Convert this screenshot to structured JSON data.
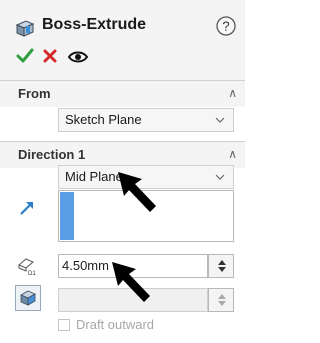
{
  "header": {
    "title": "Boss-Extrude",
    "icons": [
      "extrude-feature-icon",
      "help-icon"
    ],
    "actions": [
      {
        "name": "ok",
        "icon": "checkmark-icon",
        "color": "#2e9e3e"
      },
      {
        "name": "cancel",
        "icon": "x-icon",
        "color": "#d42a2a"
      },
      {
        "name": "preview",
        "icon": "eye-icon",
        "color": "#111111"
      }
    ]
  },
  "from": {
    "title": "From",
    "selected": "Sketch Plane"
  },
  "direction1": {
    "title": "Direction 1",
    "end_condition": "Mid Plane",
    "depth": "4.50mm",
    "draft_label": "Draft outward",
    "draft_checked": false,
    "icons": [
      "reverse-direction-arrow-icon",
      "depth-dimension-icon",
      "draft-icon"
    ]
  },
  "colors": {
    "accent": "#5b9ee8",
    "header_bg": "#f4f4f4"
  }
}
